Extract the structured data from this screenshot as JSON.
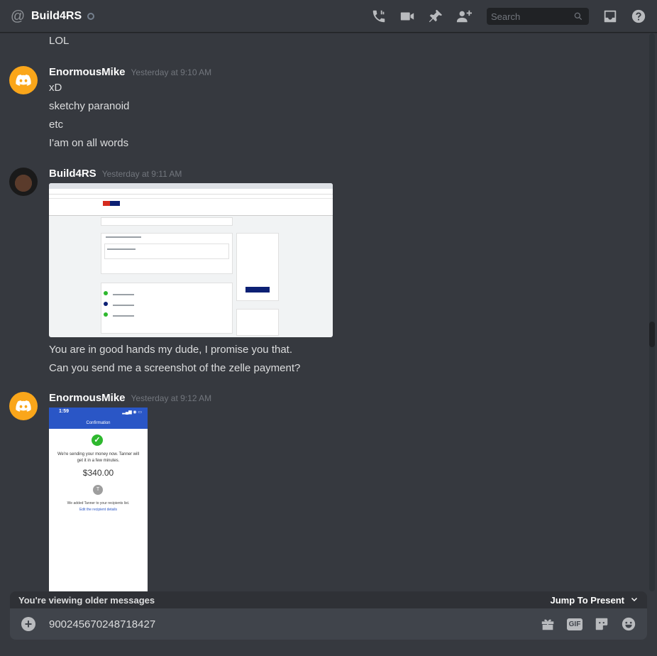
{
  "header": {
    "channel_name": "Build4RS",
    "search_placeholder": "Search",
    "icons": [
      "at-icon",
      "phone-call-icon",
      "video-call-icon",
      "pin-icon",
      "add-friend-icon",
      "search-icon",
      "inbox-icon",
      "help-icon"
    ]
  },
  "messages": [
    {
      "type": "continuation",
      "lines": [
        "LOL"
      ]
    },
    {
      "author": "EnormousMike",
      "timestamp": "Yesterday at 9:10 AM",
      "avatar": "discord-default-avatar",
      "lines": [
        "xD",
        "sketchy paranoid",
        "etc",
        "I'am on all words"
      ]
    },
    {
      "author": "Build4RS",
      "timestamp": "Yesterday at 9:11 AM",
      "avatar": "user-photo-avatar",
      "attachment": "bank-dashboard-screenshot",
      "lines": [
        "You are in good hands my dude, I promise you that.",
        "Can you send me a screenshot of the zelle payment?"
      ]
    },
    {
      "author": "EnormousMike",
      "timestamp": "Yesterday at 9:12 AM",
      "avatar": "discord-default-avatar",
      "attachment": {
        "time": "1:59",
        "title": "Confirmation",
        "message": "We're sending your money now. Tanner will get it in a few minutes.",
        "amount": "$340.00",
        "avatar_initial": "T",
        "added_note": "We added Tanner to your recipients list.",
        "edit_link": "Edit the recipient details"
      }
    }
  ],
  "older_bar": {
    "text": "You're viewing older messages",
    "jump_label": "Jump To Present"
  },
  "composer": {
    "value": "900245670248718427",
    "gif_label": "GIF",
    "icons": [
      "add-attachment-icon",
      "gift-icon",
      "gif-icon",
      "sticker-icon",
      "emoji-icon"
    ]
  },
  "colors": {
    "background": "#36393f",
    "composer": "#40444b",
    "discord_avatar": "#faa61a",
    "accent_blue": "#2a56c6"
  }
}
